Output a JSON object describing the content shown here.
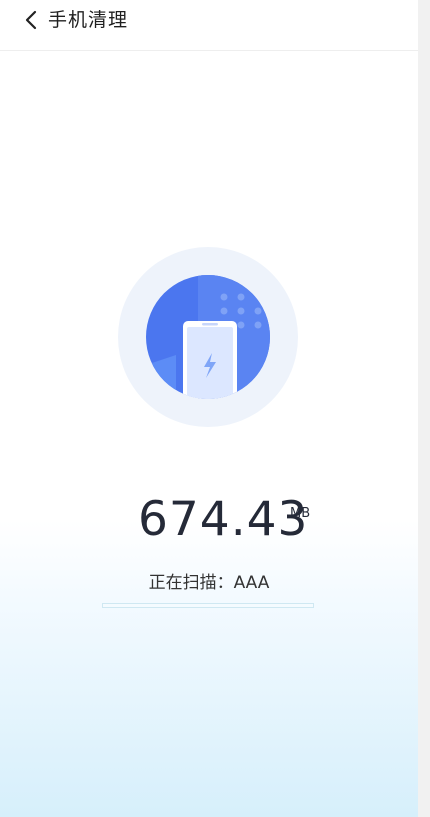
{
  "header": {
    "title": "手机清理",
    "back_icon": "chevron-left-icon"
  },
  "illustration": {
    "icon": "phone-clean-icon",
    "outer_color": "#eef3fb",
    "inner_color": "#4b76ef"
  },
  "scan": {
    "size_value": "674.43",
    "size_unit": "MB",
    "label": "正在扫描：",
    "current_item": "AAA",
    "progress": 0
  },
  "colors": {
    "accent": "#4b76ef",
    "text_dark": "#252a38",
    "progress_border": "#cfe8f2"
  }
}
